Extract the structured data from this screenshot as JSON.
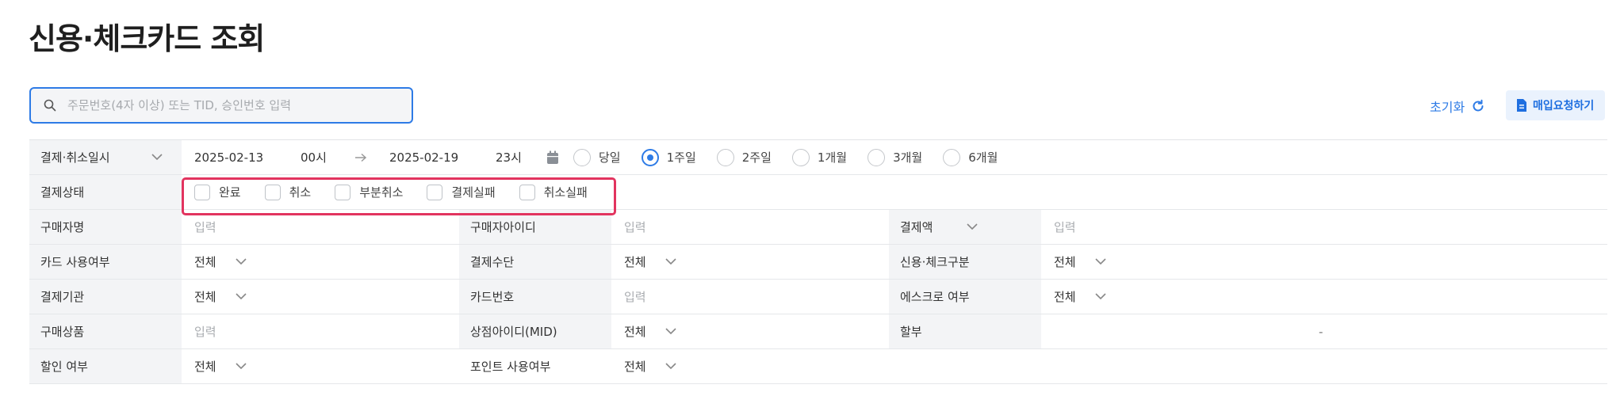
{
  "page": {
    "title": "신용·체크카드 조회"
  },
  "search": {
    "placeholder": "주문번호(4자 이상) 또는 TID, 승인번호 입력"
  },
  "actions": {
    "reset_label": "초기화",
    "purchase_request_label": "매입요청하기"
  },
  "filters": {
    "datetime": {
      "label": "결제·취소일시",
      "start_date": "2025-02-13",
      "start_hour": "00시",
      "end_date": "2025-02-19",
      "end_hour": "23시",
      "periods": [
        "당일",
        "1주일",
        "2주일",
        "1개월",
        "3개월",
        "6개월"
      ],
      "selected_period": "1주일"
    },
    "status": {
      "label": "결제상태",
      "options": [
        "완료",
        "취소",
        "부분취소",
        "결제실패",
        "취소실패"
      ]
    },
    "rows": [
      [
        {
          "label": "구매자명",
          "value": "입력",
          "type": "input"
        },
        {
          "label": "구매자아이디",
          "value": "입력",
          "type": "input"
        },
        {
          "label": "결제액",
          "value": "입력",
          "type": "input"
        }
      ],
      [
        {
          "label": "카드 사용여부",
          "value": "전체",
          "type": "select"
        },
        {
          "label": "결제수단",
          "value": "전체",
          "type": "select"
        },
        {
          "label": "신용·체크구분",
          "value": "전체",
          "type": "select"
        }
      ],
      [
        {
          "label": "결제기관",
          "value": "전체",
          "type": "select"
        },
        {
          "label": "카드번호",
          "value": "입력",
          "type": "input"
        },
        {
          "label": "에스크로 여부",
          "value": "전체",
          "type": "select"
        }
      ],
      [
        {
          "label": "구매상품",
          "value": "입력",
          "type": "input"
        },
        {
          "label": "상점아이디(MID)",
          "value": "전체",
          "type": "select"
        },
        {
          "label": "할부",
          "value": "-",
          "type": "text"
        }
      ],
      [
        {
          "label": "할인 여부",
          "value": "전체",
          "type": "select"
        },
        {
          "label": "포인트 사용여부",
          "value": "전체",
          "type": "select"
        }
      ]
    ]
  },
  "colors": {
    "accent": "#2e7be6",
    "highlight": "#e2345f",
    "label_bg": "#f3f4f6"
  }
}
